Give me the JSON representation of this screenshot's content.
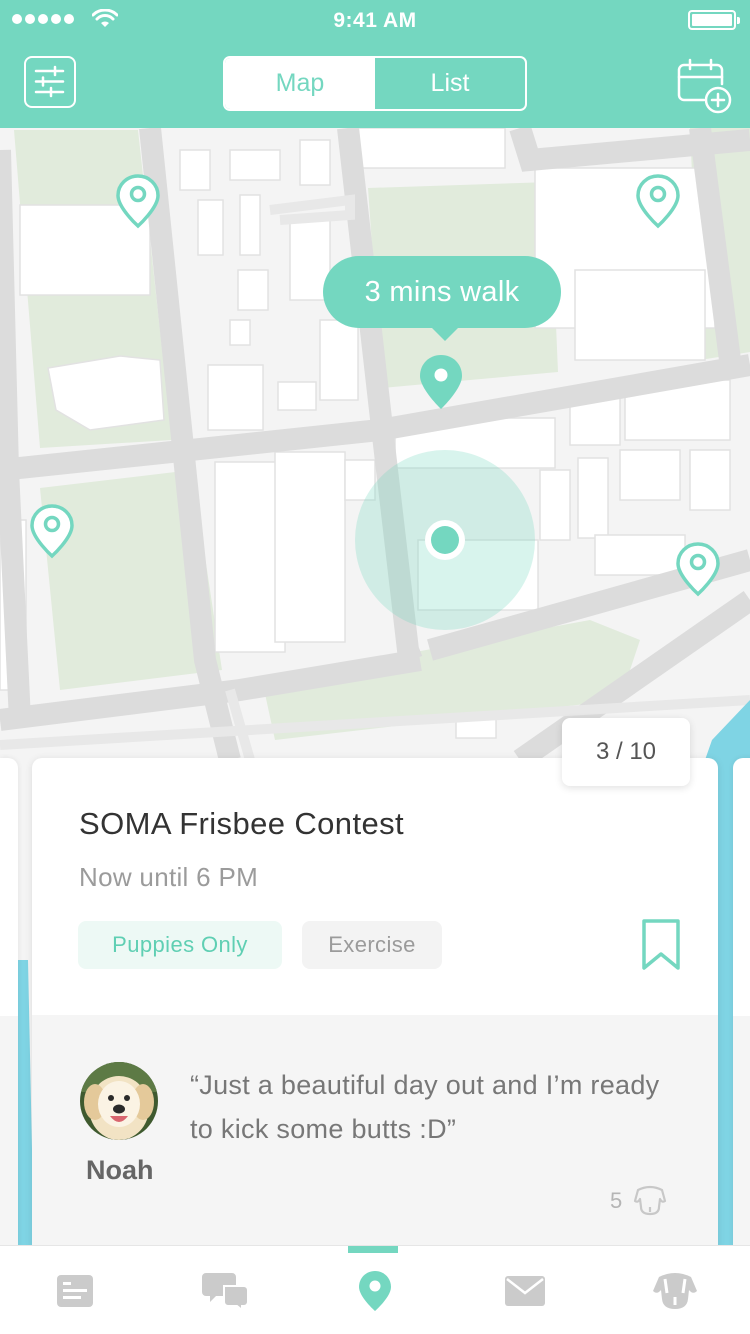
{
  "status_bar": {
    "time": "9:41 AM"
  },
  "header": {
    "segments": [
      {
        "label": "Map",
        "active": true
      },
      {
        "label": "List",
        "active": false
      }
    ]
  },
  "map": {
    "walk_tooltip": "3 mins walk"
  },
  "card_pager": {
    "label": "3 / 10"
  },
  "event_card": {
    "title": "SOMA Frisbee Contest",
    "subtitle": "Now until 6 PM",
    "tags": [
      "Puppies Only",
      "Exercise"
    ],
    "comment": {
      "author": "Noah",
      "text": "“Just a beautiful day out and I’m ready to kick some butts :D”",
      "likes": "5"
    }
  },
  "tabbar": {
    "items": [
      {
        "icon": "news-icon",
        "active": false
      },
      {
        "icon": "chat-icon",
        "active": false
      },
      {
        "icon": "map-pin-icon",
        "active": true
      },
      {
        "icon": "mail-icon",
        "active": false
      },
      {
        "icon": "dog-icon",
        "active": false
      }
    ]
  },
  "colors": {
    "accent": "#74d7c0",
    "map_park": "#e1ebdc",
    "map_water": "#7fd4e4"
  }
}
